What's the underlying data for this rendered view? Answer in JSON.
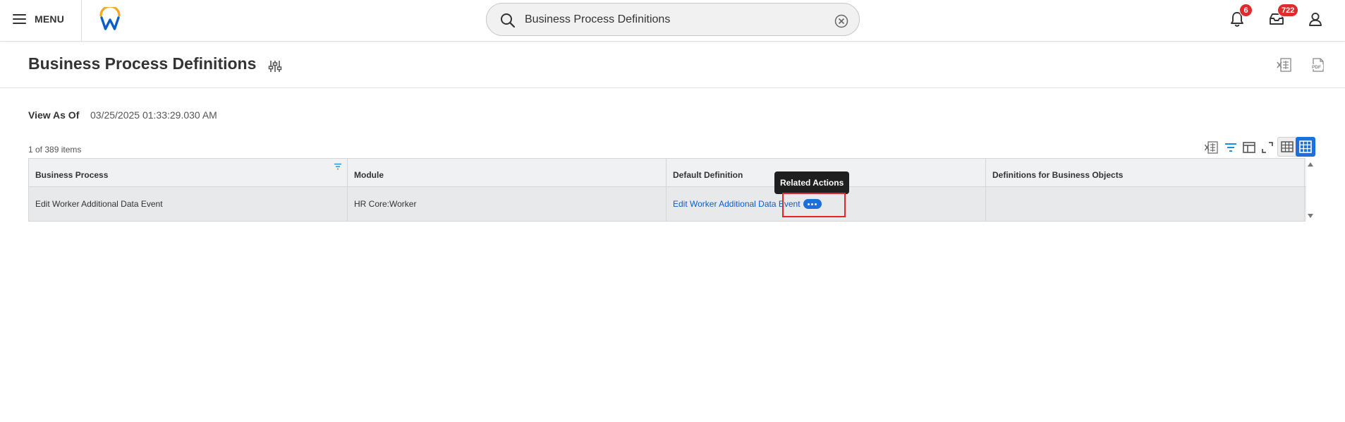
{
  "header": {
    "menu_label": "MENU",
    "search_value": "Business Process Definitions",
    "notifications_count": "6",
    "inbox_count": "722"
  },
  "page": {
    "title": "Business Process Definitions"
  },
  "view_as_of": {
    "label": "View As Of",
    "value": "03/25/2025 01:33:29.030 AM"
  },
  "grid": {
    "item_count": "1 of 389 items",
    "columns": [
      "Business Process",
      "Module",
      "Default Definition",
      "Definitions for Business Objects"
    ],
    "rows": [
      {
        "business_process": "Edit Worker Additional Data Event",
        "module": "HR Core:Worker",
        "default_definition": "Edit Worker Additional Data Event",
        "definitions_for_business_objects": ""
      }
    ]
  },
  "tooltip": {
    "text": "Related Actions"
  },
  "colors": {
    "accent_blue": "#1e6fd9",
    "link_blue": "#0b5ec8",
    "badge_red": "#de2c2c",
    "logo_orange": "#f5a623",
    "logo_blue": "#0b5ec8",
    "highlight_red": "#e3262e"
  },
  "icons": [
    "hamburger-icon",
    "workday-logo",
    "search-icon",
    "clear-icon",
    "bell-icon",
    "inbox-icon",
    "profile-icon",
    "settings-icon",
    "excel-export-icon",
    "pdf-export-icon",
    "filter-icon",
    "column-chooser-icon",
    "fullscreen-icon",
    "table-view-icon",
    "grid-view-icon",
    "scroll-up-icon",
    "scroll-down-icon",
    "related-actions-icon"
  ]
}
